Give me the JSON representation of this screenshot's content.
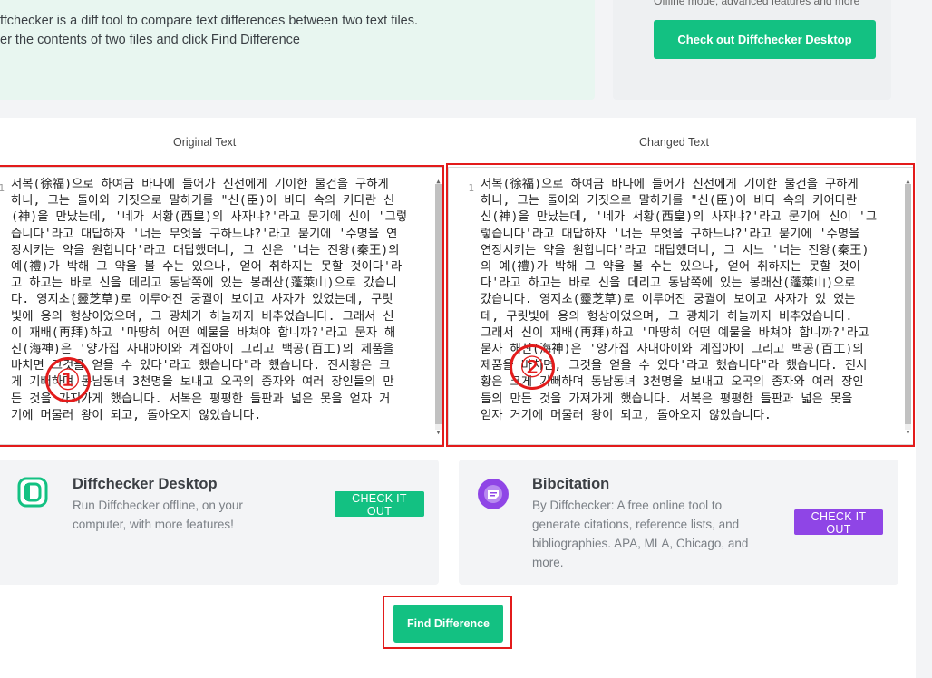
{
  "intro": {
    "line1": "ffchecker is a diff tool to compare text differences between two text files.",
    "line2": "er the contents of two files and click Find Difference"
  },
  "desktop_promo": {
    "subtitle": "Offline mode, advanced features and more",
    "button_label": "Check out Diffchecker Desktop"
  },
  "editors": {
    "original": {
      "title": "Original Text",
      "line_number": "1",
      "lines": [
        "서복(徐福)으로 하여금 바다에 들어가 신선에게 기이한 물건을 구하게",
        "하니, 그는 돌아와 거짓으로 말하기를 \"신(臣)이 바다 속의 커다란 신",
        "(神)을 만났는데, '네가 서황(西皇)의 사자냐?'라고 묻기에 신이 '그렇",
        "습니다'라고 대답하자 '너는 무엇을 구하느냐?'라고 묻기에 '수명을 연",
        "장시키는 약을 원합니다'라고 대답했더니, 그 신은 '너는 진왕(秦王)의",
        "예(禮)가 박해 그 약을 볼 수는 있으나, 얻어 취하지는 못할 것이다'라",
        "고 하고는 바로 신을 데리고 동남쪽에 있는 봉래산(蓬萊山)으로 갔습니",
        "다. 영지초(靈芝草)로 이루어진 궁궐이 보이고 사자가 있었는데, 구릿",
        "빛에 용의 형상이었으며, 그 광채가 하늘까지 비추었습니다. 그래서 신",
        "이 재배(再拜)하고 '마땅히 어떤 예물을 바쳐야 합니까?'라고 묻자 해",
        "신(海神)은 '양가집 사내아이와 계집아이 그리고 백공(百工)의 제품을",
        "바치면 그것을 얻을 수 있다'라고 했습니다\"라 했습니다. 진시황은 크",
        "게 기뻐하며 동남동녀 3천명을 보내고 오곡의 종자와 여러 장인들의 만",
        "든 것을 가지가게 했습니다. 서복은 평평한 들판과 넓은 못을 얻자 거",
        "기에 머물러 왕이 되고, 돌아오지 않았습니다."
      ]
    },
    "changed": {
      "title": "Changed Text",
      "line_number": "1",
      "lines": [
        "서복(徐福)으로 하여금 바다에 들어가 신선에게 기이한 물건을 구하게",
        "하니, 그는 돌아와 거짓으로 말하기를 \"신(臣)이 바다 속의 커어다란",
        "신(神)을 만났는데, '네가 서황(西皇)의 사자냐?'라고 묻기에 신이 '그",
        "렇습니다'라고 대답하자 '너는 무엇을 구하느냐?'라고 묻기에 '수명을",
        "연장시키는 약을 원합니다'라고 대답했더니, 그 시느 '너는 진왕(秦王)",
        "의 예(禮)가 박해 그 약을 볼 수는 있으나, 얻어 취하지는 못할 것이",
        "다'라고 하고는 바로 신을 데리고 동남쪽에 있는 봉래산(蓬萊山)으로",
        "갔습니다. 영지초(靈芝草)로 이루어진 궁궐이 보이고 사자가 있 었는",
        "데, 구릿빛에 용의 형상이었으며, 그 광채가 하늘까지 비추었습니다.",
        "그래서 신이 재배(再拜)하고 '마땅히 어떤 예물을 바쳐야 합니까?'라고",
        "묻자 해신(海神)은 '양가집 사내아이와 계집아이 그리고 백공(百工)의",
        "제품을 바치면, 그것을 얻을 수 있다'라고 했습니다\"라 했습니다. 진시",
        "황은 크게 기뻐하며 동남동녀 3천명을 보내고 오곡의 종자와 여러 장인",
        "들의 만든 것을 가져가게 했습니다. 서복은 평평한 들판과 넓은 못을",
        "얻자 거기에 머물러 왕이 되고, 돌아오지 않았습니다."
      ]
    }
  },
  "markers": {
    "left": "①",
    "right": "②"
  },
  "promos": {
    "desktop": {
      "title": "Diffchecker Desktop",
      "desc_lines": [
        "Run Diffchecker offline, on your",
        "computer, with more features!"
      ],
      "cta": "CHECK IT OUT",
      "accent": "#13c182"
    },
    "bibcitation": {
      "title": "Bibcitation",
      "desc_lines": [
        "By Diffchecker: A free online tool to",
        "generate citations, reference lists, and",
        "bibliographies. APA, MLA, Chicago, and",
        "more."
      ],
      "cta": "CHECK IT OUT",
      "accent": "#8f45e6"
    }
  },
  "find_button": {
    "label": "Find Difference",
    "color": "#13c182"
  },
  "colors": {
    "highlight": "#e31b1b",
    "banner": "#e8f6f0"
  }
}
